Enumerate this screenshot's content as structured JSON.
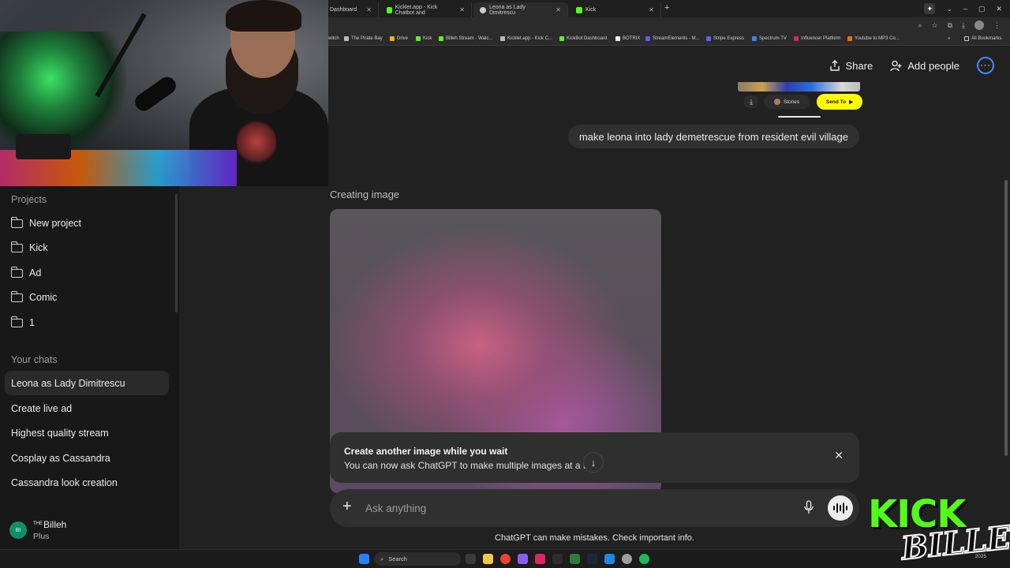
{
  "browser": {
    "tabs": [
      {
        "label": "Dashboard",
        "fav_color": "#3f9c5c",
        "active": false
      },
      {
        "label": "Kicklet.app - Kick Chatbot and",
        "fav_color": "#53fc18",
        "active": false
      },
      {
        "label": "Leona as Lady Dimitrescu",
        "fav_color": "#cccccc",
        "active": true
      },
      {
        "label": "Kick",
        "fav_color": "#53fc18",
        "active": false
      }
    ],
    "bookmarks": [
      {
        "label": "witch",
        "color": "#8a5cf6"
      },
      {
        "label": "The Pirate Bay",
        "color": "#bbbbbb"
      },
      {
        "label": "Drive",
        "color": "#f4b400"
      },
      {
        "label": "Kick",
        "color": "#53fc18"
      },
      {
        "label": "Billeh Stream - Watc...",
        "color": "#53fc18"
      },
      {
        "label": "Kicklet.app - Kick C...",
        "color": "#bbbbbb"
      },
      {
        "label": "KickBot Dashboard",
        "color": "#53fc18"
      },
      {
        "label": "BOTRIX",
        "color": "#eeeeee"
      },
      {
        "label": "StreamElements - M...",
        "color": "#5b5bff"
      },
      {
        "label": "Stripe Express",
        "color": "#6a5cff"
      },
      {
        "label": "Spectrum TV",
        "color": "#3b82f6"
      },
      {
        "label": "Influencer Platform",
        "color": "#e0245e"
      },
      {
        "label": "Youtube to MP3 Co...",
        "color": "#ff6a00"
      },
      {
        "label": "All Bookmarks",
        "color": "#cccccc"
      }
    ]
  },
  "sidebar": {
    "projects_heading": "Projects",
    "projects": [
      {
        "label": "New project",
        "icon": "folder-plus-icon"
      },
      {
        "label": "Kick",
        "icon": "folder-icon"
      },
      {
        "label": "Ad",
        "icon": "folder-icon"
      },
      {
        "label": "Comic",
        "icon": "folder-icon"
      },
      {
        "label": "1",
        "icon": "folder-icon"
      }
    ],
    "chats_heading": "Your chats",
    "chats": [
      {
        "label": "Leona as Lady Dimitrescu",
        "active": true
      },
      {
        "label": "Create live ad",
        "active": false
      },
      {
        "label": "Highest quality stream",
        "active": false
      },
      {
        "label": "Cosplay as Cassandra",
        "active": false
      },
      {
        "label": "Cassandra look creation",
        "active": false
      }
    ],
    "profile": {
      "initials": "BI",
      "name_prefix": "THE",
      "name": "Billeh",
      "plan": "Plus"
    }
  },
  "header": {
    "share_label": "Share",
    "add_people_label": "Add people"
  },
  "upload_preview": {
    "stories_label": "Stories",
    "send_to_label": "Send To"
  },
  "conversation": {
    "user_message": "make leona into lady demetrescue from resident evil village",
    "status": "Creating image"
  },
  "notice": {
    "title": "Create another image while you wait",
    "body": "You can now ask ChatGPT to make multiple images at a t  ."
  },
  "composer": {
    "placeholder": "Ask anything"
  },
  "disclaimer": "ChatGPT can make mistakes. Check important info.",
  "taskbar": {
    "search_label": "Search",
    "date": "2025"
  },
  "overlay": {
    "kick_text": "KICK",
    "billeh_text": "BILLEH"
  }
}
